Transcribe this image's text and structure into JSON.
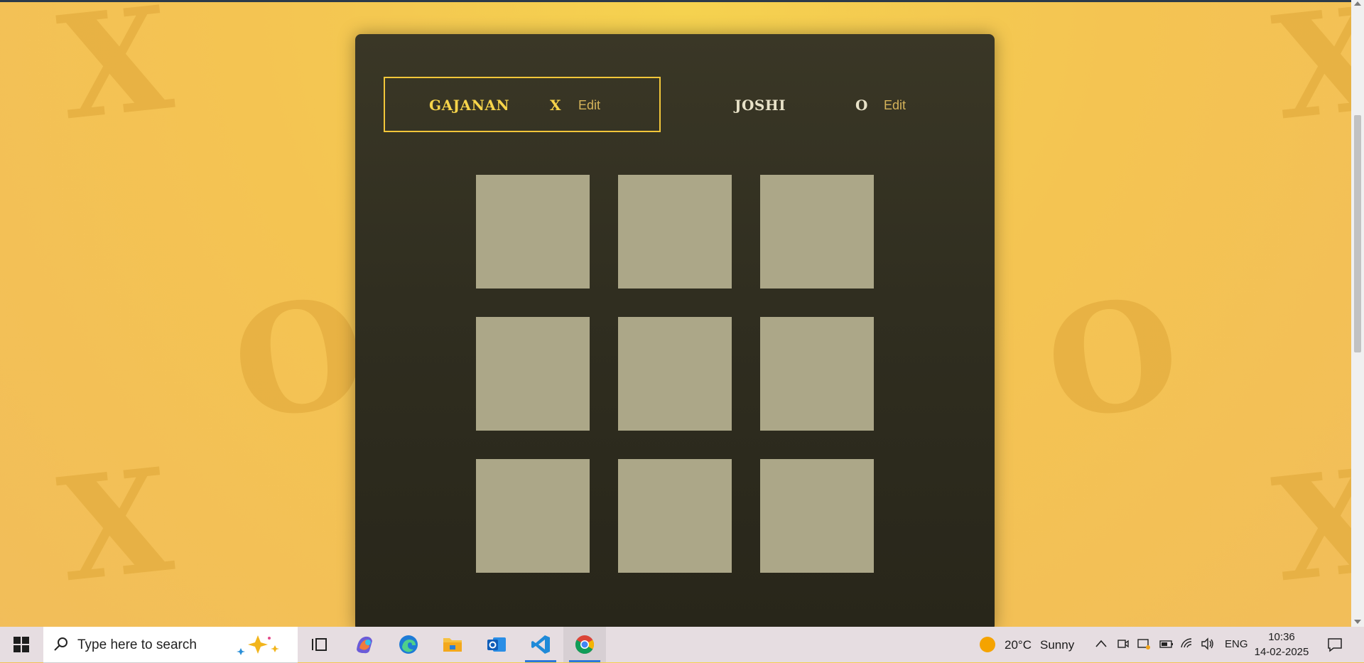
{
  "players": [
    {
      "name": "GAJANAN",
      "symbol": "X",
      "edit_label": "Edit",
      "active": true
    },
    {
      "name": "JOSHI",
      "symbol": "O",
      "edit_label": "Edit",
      "active": false
    }
  ],
  "board": [
    [
      "",
      "",
      ""
    ],
    [
      "",
      "",
      ""
    ],
    [
      "",
      "",
      ""
    ]
  ],
  "background_decorations": [
    "X",
    "O",
    "X",
    "X",
    "O",
    "X"
  ],
  "colors": {
    "accent": "#f6d44a",
    "board_bg": "#302e20",
    "cell": "#aca788",
    "page_bg": "#f4c452"
  },
  "taskbar": {
    "search_placeholder": "Type here to search",
    "apps": [
      "task-view",
      "copilot",
      "edge",
      "file-explorer",
      "outlook",
      "vscode",
      "chrome"
    ],
    "weather": {
      "temp": "20°C",
      "condition": "Sunny"
    },
    "language": "ENG",
    "time": "10:36",
    "date": "14-02-2025"
  }
}
